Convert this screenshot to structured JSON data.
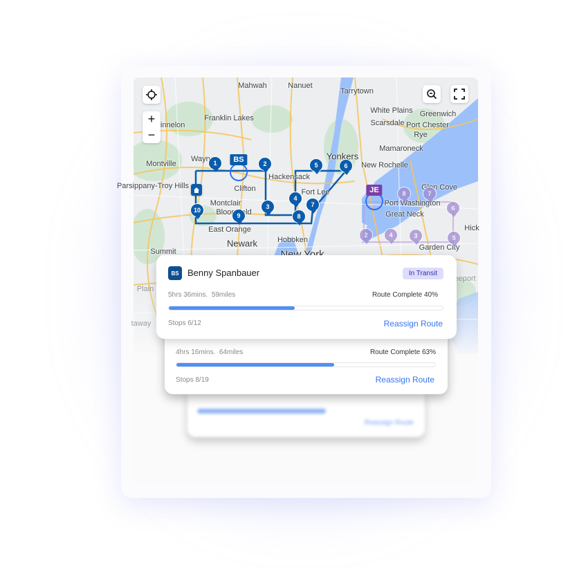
{
  "colors": {
    "route_blue": "#0b5cab",
    "accent": "#3574f0",
    "progress": "#4f8ef7",
    "badge_bg": "#dedcfd",
    "badge_text": "#3132a8",
    "purple": "#7a3fa8"
  },
  "map": {
    "controls": {
      "locate": "crosshair-icon",
      "zoom_in": "+",
      "zoom_out": "−",
      "search_zoom": "zoom-search-icon",
      "fullscreen": "fullscreen-icon"
    },
    "labels": [
      "Mahwah",
      "Nanuet",
      "Tarrytown",
      "Franklin Lakes",
      "Kinnelon",
      "White Plains",
      "Greenwich",
      "Scarsdale",
      "Port Chester",
      "Rye",
      "Mamaroneck",
      "Montville",
      "Yonkers",
      "Wayne",
      "New Rochelle",
      "Hackensack",
      "Parsippany-Troy Hills",
      "Clifton",
      "Fort Lee",
      "Glen Cove",
      "Montclair",
      "Port Washington",
      "Bloomfield",
      "Great Neck",
      "East Orange",
      "Hick",
      "Newark",
      "Hoboken",
      "Garden City",
      "New York",
      "Summit",
      "Plain",
      "taway",
      "eeport"
    ],
    "driver_tags": {
      "bs": "BS",
      "je": "JE"
    },
    "route_stops": [
      "1",
      "2",
      "3",
      "4",
      "5",
      "6",
      "7",
      "8",
      "9",
      "10"
    ],
    "other_stops": [
      "8",
      "7",
      "6",
      "2",
      "4",
      "3",
      "5"
    ]
  },
  "cards": [
    {
      "initials": "BS",
      "name": "Benny Spanbauer",
      "status": "In Transit",
      "duration": "5hrs 36mins.",
      "distance": "59miles",
      "route_complete": "Route Complete 40%",
      "progress": 0.46,
      "stops": "Stops  6/12",
      "action": "Reassign Route"
    },
    {
      "duration": "4hrs 16mins.",
      "distance": "64miles",
      "route_complete": "Route Complete 63%",
      "progress": 0.61,
      "stops": "Stops  8/19",
      "action": "Reassign Route"
    },
    {
      "progress": 0.58,
      "action": "Reassign Route"
    }
  ]
}
